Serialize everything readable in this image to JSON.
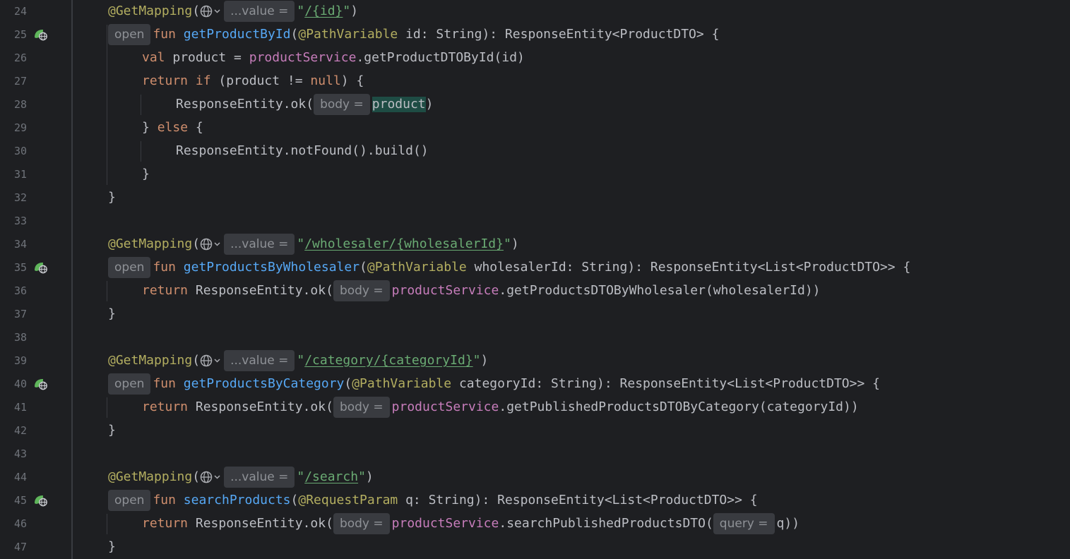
{
  "editor": {
    "colors": {
      "background": "#1e1f22",
      "line_number": "#6f737a",
      "annotation": "#b3ae60",
      "keyword": "#cf8e6d",
      "function": "#56a8f5",
      "property": "#c77dbb",
      "string": "#6aab73",
      "default": "#bcbec4",
      "inlay_bg": "#393b40",
      "inlay_text": "#8e9196",
      "highlight": "#1e4c44"
    },
    "lines": [
      {
        "num": "24",
        "gutter_icon": null,
        "indent": 3,
        "tokens": [
          {
            "t": "@GetMapping",
            "c": "ann"
          },
          {
            "t": "(",
            "c": "txt"
          },
          {
            "kind": "globe"
          },
          {
            "kind": "hint",
            "t": "...value ="
          },
          {
            "t": "\"",
            "c": "str"
          },
          {
            "t": "/{id}",
            "c": "strlink"
          },
          {
            "t": "\"",
            "c": "str"
          },
          {
            "t": ")",
            "c": "txt"
          }
        ]
      },
      {
        "num": "25",
        "gutter_icon": "endpoint-globe-icon",
        "indent": 3,
        "tokens": [
          {
            "kind": "hint",
            "t": "open"
          },
          {
            "t": "fun ",
            "c": "kw"
          },
          {
            "t": "getProductById",
            "c": "fn"
          },
          {
            "t": "(",
            "c": "txt"
          },
          {
            "t": "@PathVariable",
            "c": "ann"
          },
          {
            "t": " id: String): ResponseEntity<ProductDTO> {",
            "c": "txt"
          }
        ]
      },
      {
        "num": "26",
        "gutter_icon": null,
        "indent": 4,
        "tokens": [
          {
            "t": "val ",
            "c": "kw"
          },
          {
            "t": "product = ",
            "c": "txt"
          },
          {
            "t": "productService",
            "c": "prop"
          },
          {
            "t": ".getProductDTOById(id)",
            "c": "txt"
          }
        ]
      },
      {
        "num": "27",
        "gutter_icon": null,
        "indent": 4,
        "tokens": [
          {
            "t": "return if ",
            "c": "kw"
          },
          {
            "t": "(product != ",
            "c": "txt"
          },
          {
            "t": "null",
            "c": "kw"
          },
          {
            "t": ") {",
            "c": "txt"
          }
        ]
      },
      {
        "num": "28",
        "gutter_icon": null,
        "indent": 5,
        "tokens": [
          {
            "t": "ResponseEntity.ok(",
            "c": "txt"
          },
          {
            "kind": "hint",
            "t": "body ="
          },
          {
            "t": "product",
            "c": "hl"
          },
          {
            "t": ")",
            "c": "txt"
          }
        ]
      },
      {
        "num": "29",
        "gutter_icon": null,
        "indent": 4,
        "tokens": [
          {
            "t": "} ",
            "c": "txt"
          },
          {
            "t": "else ",
            "c": "kw"
          },
          {
            "t": "{",
            "c": "txt"
          }
        ]
      },
      {
        "num": "30",
        "gutter_icon": null,
        "indent": 5,
        "tokens": [
          {
            "t": "ResponseEntity.notFound().build()",
            "c": "txt"
          }
        ]
      },
      {
        "num": "31",
        "gutter_icon": null,
        "indent": 4,
        "tokens": [
          {
            "t": "}",
            "c": "txt"
          }
        ]
      },
      {
        "num": "32",
        "gutter_icon": null,
        "indent": 3,
        "tokens": [
          {
            "t": "}",
            "c": "txt"
          }
        ]
      },
      {
        "num": "33",
        "gutter_icon": null,
        "indent": 3,
        "tokens": []
      },
      {
        "num": "34",
        "gutter_icon": null,
        "indent": 3,
        "tokens": [
          {
            "t": "@GetMapping",
            "c": "ann"
          },
          {
            "t": "(",
            "c": "txt"
          },
          {
            "kind": "globe"
          },
          {
            "kind": "hint",
            "t": "...value ="
          },
          {
            "t": "\"",
            "c": "str"
          },
          {
            "t": "/wholesaler/{wholesalerId}",
            "c": "strlink"
          },
          {
            "t": "\"",
            "c": "str"
          },
          {
            "t": ")",
            "c": "txt"
          }
        ]
      },
      {
        "num": "35",
        "gutter_icon": "endpoint-globe-icon",
        "indent": 3,
        "tokens": [
          {
            "kind": "hint",
            "t": "open"
          },
          {
            "t": "fun ",
            "c": "kw"
          },
          {
            "t": "getProductsByWholesaler",
            "c": "fn"
          },
          {
            "t": "(",
            "c": "txt"
          },
          {
            "t": "@PathVariable",
            "c": "ann"
          },
          {
            "t": " wholesalerId: String): ResponseEntity<List<ProductDTO>> {",
            "c": "txt"
          }
        ]
      },
      {
        "num": "36",
        "gutter_icon": null,
        "indent": 4,
        "tokens": [
          {
            "t": "return ",
            "c": "kw"
          },
          {
            "t": "ResponseEntity.ok(",
            "c": "txt"
          },
          {
            "kind": "hint",
            "t": "body ="
          },
          {
            "t": "productService",
            "c": "prop"
          },
          {
            "t": ".getProductsDTOByWholesaler(wholesalerId))",
            "c": "txt"
          }
        ]
      },
      {
        "num": "37",
        "gutter_icon": null,
        "indent": 3,
        "tokens": [
          {
            "t": "}",
            "c": "txt"
          }
        ]
      },
      {
        "num": "38",
        "gutter_icon": null,
        "indent": 3,
        "tokens": []
      },
      {
        "num": "39",
        "gutter_icon": null,
        "indent": 3,
        "tokens": [
          {
            "t": "@GetMapping",
            "c": "ann"
          },
          {
            "t": "(",
            "c": "txt"
          },
          {
            "kind": "globe"
          },
          {
            "kind": "hint",
            "t": "...value ="
          },
          {
            "t": "\"",
            "c": "str"
          },
          {
            "t": "/category/{categoryId}",
            "c": "strlink"
          },
          {
            "t": "\"",
            "c": "str"
          },
          {
            "t": ")",
            "c": "txt"
          }
        ]
      },
      {
        "num": "40",
        "gutter_icon": "endpoint-globe-icon",
        "indent": 3,
        "tokens": [
          {
            "kind": "hint",
            "t": "open"
          },
          {
            "t": "fun ",
            "c": "kw"
          },
          {
            "t": "getProductsByCategory",
            "c": "fn"
          },
          {
            "t": "(",
            "c": "txt"
          },
          {
            "t": "@PathVariable",
            "c": "ann"
          },
          {
            "t": " categoryId: String): ResponseEntity<List<ProductDTO>> {",
            "c": "txt"
          }
        ]
      },
      {
        "num": "41",
        "gutter_icon": null,
        "indent": 4,
        "tokens": [
          {
            "t": "return ",
            "c": "kw"
          },
          {
            "t": "ResponseEntity.ok(",
            "c": "txt"
          },
          {
            "kind": "hint",
            "t": "body ="
          },
          {
            "t": "productService",
            "c": "prop"
          },
          {
            "t": ".getPublishedProductsDTOByCategory(categoryId))",
            "c": "txt"
          }
        ]
      },
      {
        "num": "42",
        "gutter_icon": null,
        "indent": 3,
        "tokens": [
          {
            "t": "}",
            "c": "txt"
          }
        ]
      },
      {
        "num": "43",
        "gutter_icon": null,
        "indent": 3,
        "tokens": []
      },
      {
        "num": "44",
        "gutter_icon": null,
        "indent": 3,
        "tokens": [
          {
            "t": "@GetMapping",
            "c": "ann"
          },
          {
            "t": "(",
            "c": "txt"
          },
          {
            "kind": "globe"
          },
          {
            "kind": "hint",
            "t": "...value ="
          },
          {
            "t": "\"",
            "c": "str"
          },
          {
            "t": "/search",
            "c": "strlink"
          },
          {
            "t": "\"",
            "c": "str"
          },
          {
            "t": ")",
            "c": "txt"
          }
        ]
      },
      {
        "num": "45",
        "gutter_icon": "endpoint-globe-icon",
        "indent": 3,
        "tokens": [
          {
            "kind": "hint",
            "t": "open"
          },
          {
            "t": "fun ",
            "c": "kw"
          },
          {
            "t": "searchProducts",
            "c": "fn"
          },
          {
            "t": "(",
            "c": "txt"
          },
          {
            "t": "@RequestParam",
            "c": "ann"
          },
          {
            "t": " q: String): ResponseEntity<List<ProductDTO>> {",
            "c": "txt"
          }
        ]
      },
      {
        "num": "46",
        "gutter_icon": null,
        "indent": 4,
        "tokens": [
          {
            "t": "return ",
            "c": "kw"
          },
          {
            "t": "ResponseEntity.ok(",
            "c": "txt"
          },
          {
            "kind": "hint",
            "t": "body ="
          },
          {
            "t": "productService",
            "c": "prop"
          },
          {
            "t": ".searchPublishedProductsDTO(",
            "c": "txt"
          },
          {
            "kind": "hint",
            "t": "query ="
          },
          {
            "t": "q))",
            "c": "txt"
          }
        ]
      },
      {
        "num": "47",
        "gutter_icon": null,
        "indent": 3,
        "tokens": [
          {
            "t": "}",
            "c": "txt"
          }
        ]
      }
    ]
  }
}
